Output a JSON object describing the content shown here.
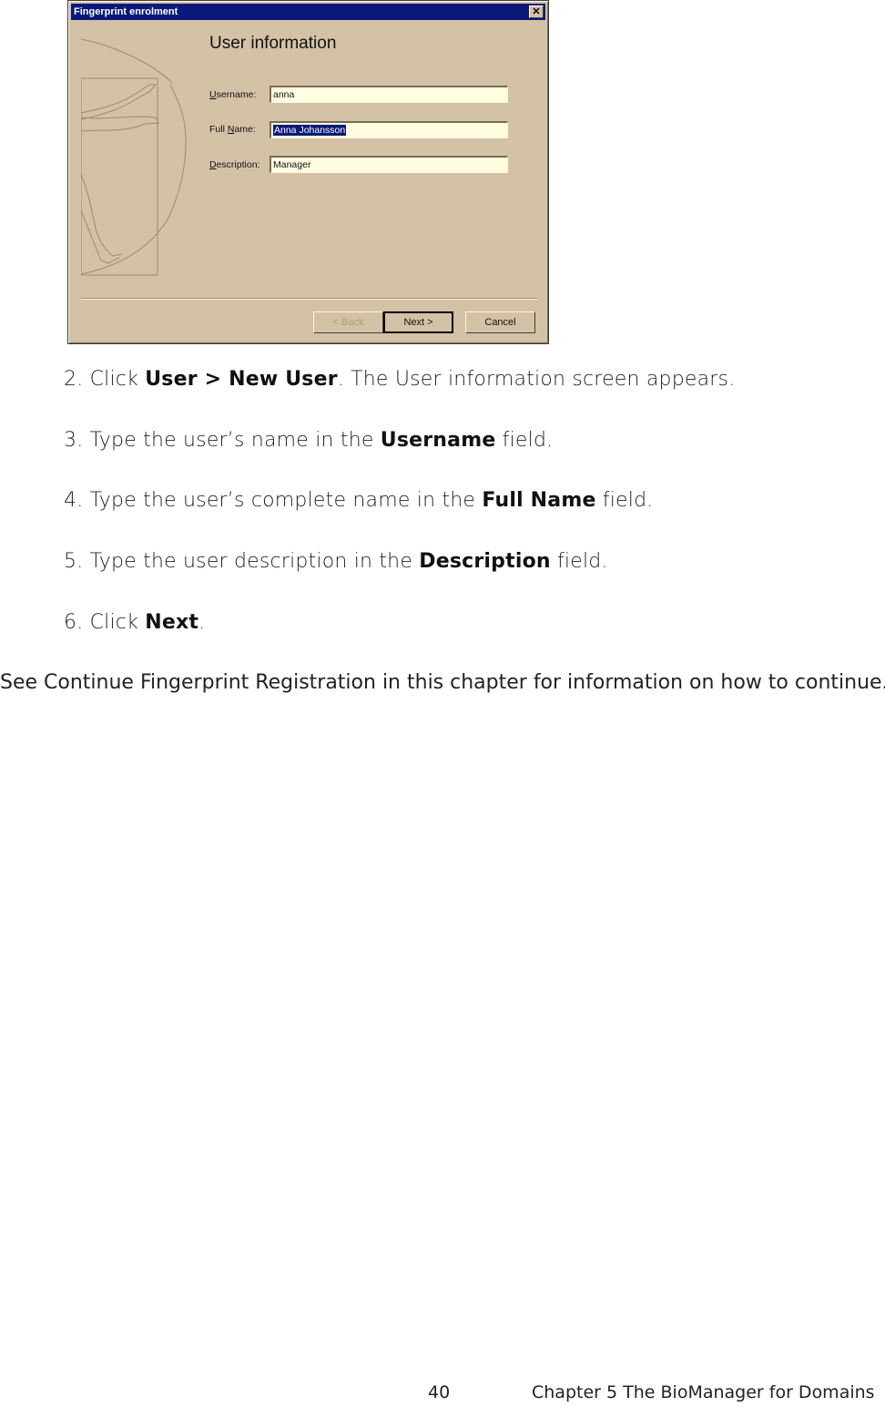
{
  "dialog": {
    "title": "Fingerprint enrolment",
    "close_icon": "close-icon",
    "heading": "User information",
    "fields": [
      {
        "label_mn": "U",
        "label_rest": "sername:",
        "value": "anna",
        "selected": false
      },
      {
        "label_pre": "Full ",
        "label_mn": "N",
        "label_rest": "ame:",
        "value": "Anna Johansson",
        "selected": true
      },
      {
        "label_mn": "D",
        "label_rest": "escription:",
        "value": "Manager",
        "selected": false
      }
    ],
    "buttons": {
      "back": "< Back",
      "next": "Next >",
      "cancel": "Cancel"
    }
  },
  "steps": [
    {
      "num": "2.",
      "pre": "Click ",
      "bold": "User > New User",
      "post": ". The User information screen appears."
    },
    {
      "num": "3.",
      "pre": "Type the user’s name in the ",
      "bold": "Username",
      "post": " field."
    },
    {
      "num": "4.",
      "pre": "Type the user’s complete name in the ",
      "bold": "Full Name",
      "post": " field."
    },
    {
      "num": "5.",
      "pre": "Type the user description in the ",
      "bold": "Description",
      "post": " field."
    },
    {
      "num": "6.",
      "pre": "Click ",
      "bold": "Next",
      "post": "."
    }
  ],
  "note": "See Continue Fingerprint Registration in this chapter for information on how to continue.",
  "footer": {
    "page_number": "40",
    "chapter": "Chapter 5 The BioManager for Domains"
  }
}
